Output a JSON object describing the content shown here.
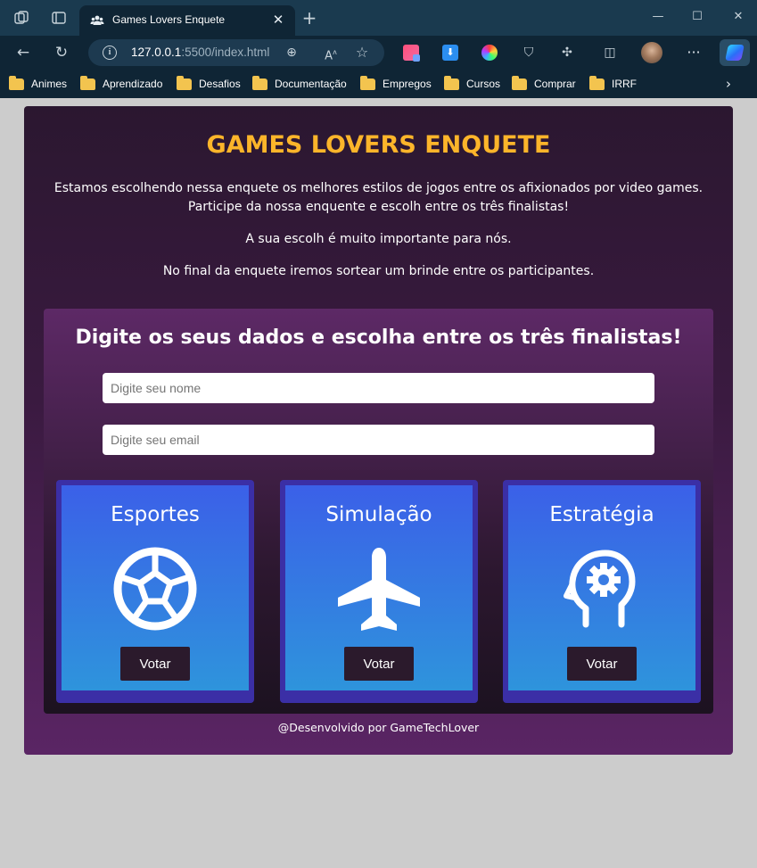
{
  "browser": {
    "tab_title": "Games Lovers Enquete",
    "url_host": "127.0.0.1",
    "url_rest": ":5500/index.html",
    "icons": [
      "workspaces-icon",
      "tab-actions-icon",
      "team-favicon-icon",
      "close-icon",
      "new-tab-icon",
      "minimize-icon",
      "maximize-icon",
      "window-close-icon",
      "back-icon",
      "refresh-icon",
      "site-info-icon",
      "zoom-icon",
      "read-aloud-icon",
      "favorite-star-icon",
      "extension-icon",
      "download-icon",
      "color-wheel-icon",
      "shield-icon",
      "puzzle-icon",
      "split-screen-icon",
      "profile-avatar",
      "more-icon",
      "copilot-icon"
    ],
    "bookmarks": [
      "Animes",
      "Aprendizado",
      "Desafios",
      "Documentação",
      "Empregos",
      "Cursos",
      "Comprar",
      "IRRF"
    ]
  },
  "page": {
    "title": "GAMES LOVERS ENQUETE",
    "intro_line1": "Estamos escolhendo nessa enquete os melhores estilos de jogos entre os afixionados por video games.",
    "intro_line2": "Participe da nossa enquente e escolh entre os três finalistas!",
    "intro_line3": "A sua escolh é muito importante para nós.",
    "intro_line4": "No final da enquete iremos sortear um brinde entre os participantes.",
    "form_title": "Digite os seus dados e escolha entre os três finalistas!",
    "name_placeholder": "Digite seu nome",
    "email_placeholder": "Digite seu email",
    "options": [
      {
        "name": "Esportes",
        "icon": "soccer-ball-icon",
        "button": "Votar"
      },
      {
        "name": "Simulação",
        "icon": "airplane-icon",
        "button": "Votar"
      },
      {
        "name": "Estratégia",
        "icon": "head-gear-icon",
        "button": "Votar"
      }
    ],
    "footer": "@Desenvolvido por GameTechLover",
    "colors": {
      "title": "#fcb52a",
      "card_top": "#2b1730",
      "card_bottom": "#5a2564",
      "option_border": "#3b2fa6",
      "option_top": "#3b60e8",
      "option_bottom": "#2e94dc",
      "button": "#2b1a2c"
    }
  }
}
